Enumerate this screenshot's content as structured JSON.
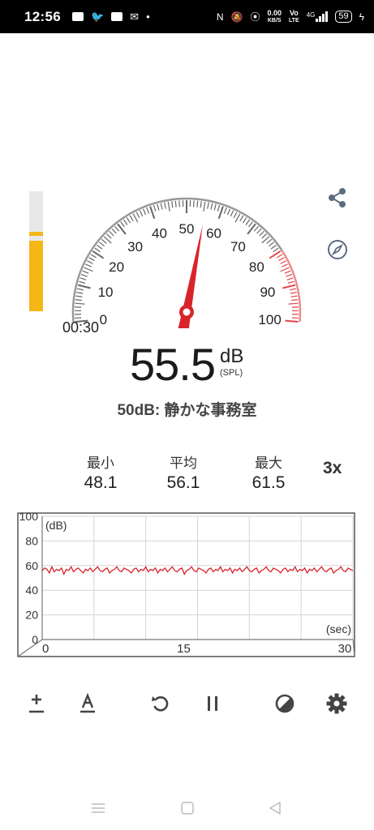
{
  "status": {
    "time": "12:56",
    "net_speed_value": "0.00",
    "net_speed_unit": "KB/S",
    "volte_top": "Vo",
    "volte_bottom": "LTE",
    "network_type": "4G",
    "battery": "59"
  },
  "meter": {
    "timer": "00:30",
    "current_db": "55.5",
    "unit": "dB",
    "unit_sub": "(SPL)",
    "description": "50dB: 静かな事務室",
    "needle_value": 55.5,
    "level_fraction": 0.63,
    "peak_fraction": 0.63,
    "scale_labels": [
      "0",
      "10",
      "20",
      "30",
      "40",
      "50",
      "60",
      "70",
      "80",
      "90",
      "100"
    ],
    "accent_color": "#d9232a",
    "level_color": "#f5b716"
  },
  "stats": {
    "min_label": "最小",
    "min_value": "48.1",
    "avg_label": "平均",
    "avg_value": "56.1",
    "max_label": "最大",
    "max_value": "61.5",
    "multiplier": "3x"
  },
  "graph": {
    "y_ticks": [
      "100",
      "80",
      "60",
      "40",
      "20",
      "0"
    ],
    "x_ticks": [
      "0",
      "15",
      "30"
    ],
    "y_unit": "(dB)",
    "x_unit": "(sec)",
    "series": [
      56,
      58,
      57,
      54,
      59,
      55,
      57,
      56,
      58,
      53,
      57,
      56,
      59,
      55,
      57,
      58,
      56,
      54,
      57,
      56,
      58,
      55,
      57,
      59,
      56,
      55,
      57,
      58,
      54,
      56,
      57,
      59,
      56,
      55,
      58,
      57,
      56,
      54,
      57,
      58,
      55,
      57,
      56,
      59,
      55,
      57,
      56,
      58,
      54,
      57,
      56,
      58,
      55,
      57,
      59,
      56,
      55,
      57,
      58,
      53,
      56,
      57,
      59,
      56,
      55,
      58,
      57,
      56,
      54,
      57,
      58,
      55,
      57,
      56,
      59,
      55,
      57,
      56,
      58,
      54,
      57,
      56,
      58,
      55,
      57,
      59,
      56,
      55,
      57,
      58,
      54,
      56,
      57,
      59,
      56,
      55,
      58,
      57,
      56,
      54,
      57,
      58,
      55,
      57,
      56,
      59,
      55,
      57,
      56,
      58,
      54,
      57,
      56,
      58,
      55,
      57,
      59,
      56,
      55,
      57,
      58,
      54,
      56,
      57,
      59,
      56,
      55,
      58,
      57,
      56
    ]
  },
  "toolbar": {
    "calibrate_icon": "plus-minus-icon",
    "text_icon": "text-a-icon",
    "reset_icon": "reset-icon",
    "pause_icon": "pause-icon",
    "theme_icon": "contrast-icon",
    "settings_icon": "gear-icon"
  }
}
